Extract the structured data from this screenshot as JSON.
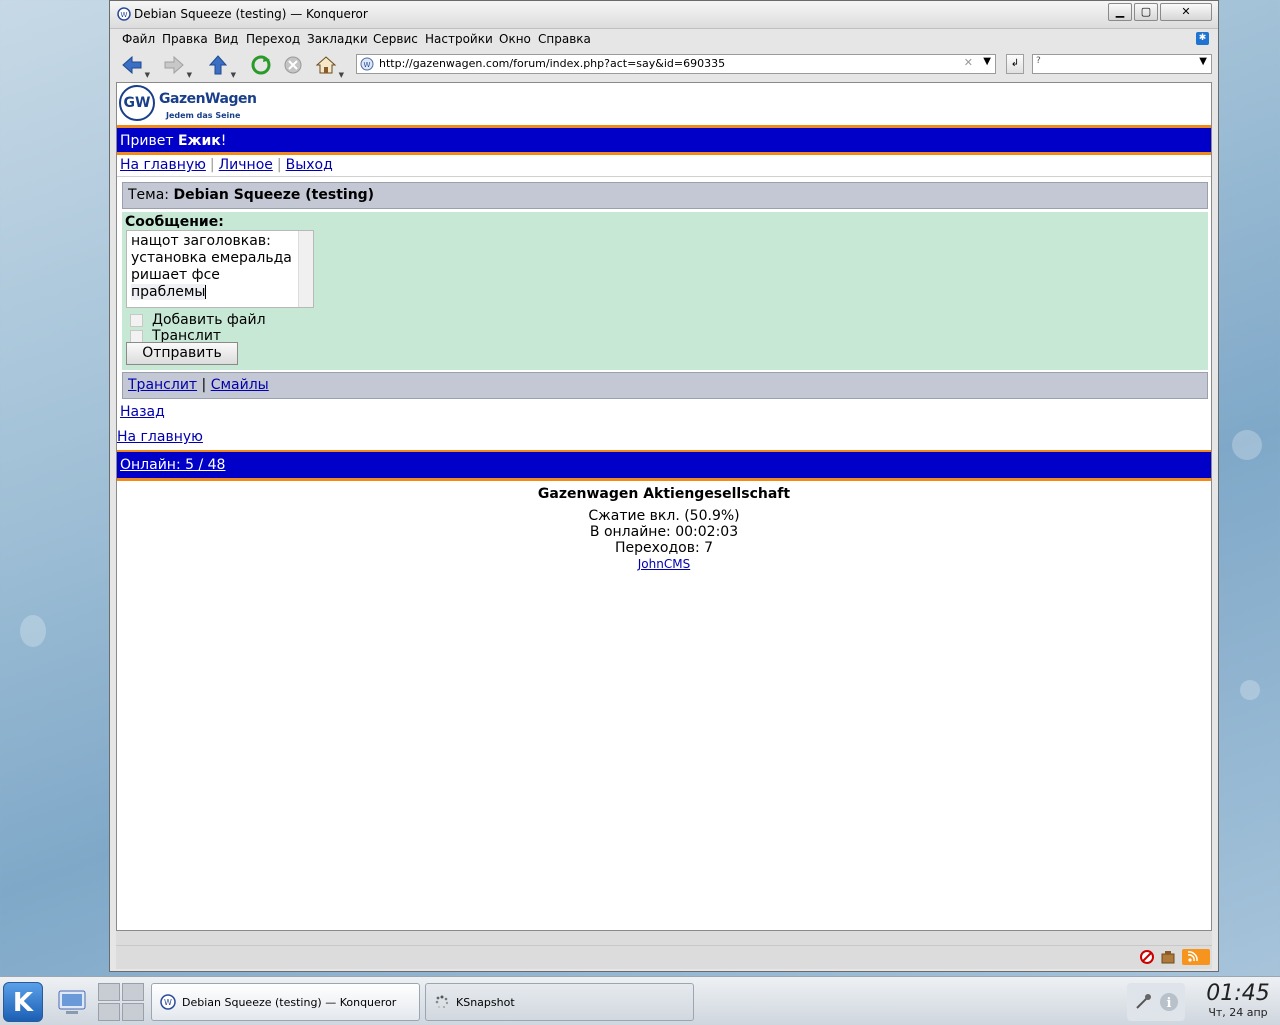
{
  "window": {
    "title": "Debian Squeeze (testing) — Konqueror",
    "buttons": {
      "minimize": "▁",
      "maximize": "▢",
      "close": "✕"
    }
  },
  "menu": [
    "Файл",
    "Правка",
    "Вид",
    "Переход",
    "Закладки",
    "Сервис",
    "Настройки",
    "Окно",
    "Справка"
  ],
  "toolbar": {
    "url": "http://gazenwagen.com/forum/index.php?act=say&id=690335",
    "search_placeholder": ""
  },
  "site": {
    "logo_name": "GazenWagen",
    "logo_tagline": "Jedem das Seine",
    "greeting_prefix": "Привет ",
    "username": "Ежик",
    "greeting_suffix": "!",
    "nav": [
      "На главную",
      "Личное",
      "Выход"
    ],
    "topic_label": "Тема: ",
    "topic_title": "Debian Squeeze (testing)",
    "message_label": "Сообщение:",
    "message_lines": [
      "нащот заголовкав:",
      "установка емеральда",
      "ришает фсе"
    ],
    "message_last_line": "праблемы",
    "checkbox_attach": "Добавить файл",
    "checkbox_translit": "Транслит",
    "submit_label": "Отправить",
    "opts_translit": "Транслит",
    "opts_sep": "|",
    "opts_smiles": "Смайлы",
    "back_link": "Назад",
    "home_link": "На главную",
    "online": "Онлайн: 5 / 48",
    "footer": {
      "company": "Gazenwagen Aktiengesellschaft",
      "compression": "Сжатие вкл. (50.9%)",
      "online_time": "В онлайне: 00:02:03",
      "transitions": "Переходов: 7",
      "cms_link": "JohnCMS"
    }
  },
  "taskbar": {
    "tasks": [
      {
        "label": "Debian Squeeze (testing) — Konqueror",
        "active": true
      },
      {
        "label": "KSnapshot",
        "active": false
      }
    ],
    "time": "01:45",
    "date": "Чт, 24 апр"
  },
  "colors": {
    "accent_blue": "#0000c8",
    "accent_orange": "#f08a1c",
    "form_green": "#c8e8d6",
    "box_grey": "#c4c8d4"
  }
}
